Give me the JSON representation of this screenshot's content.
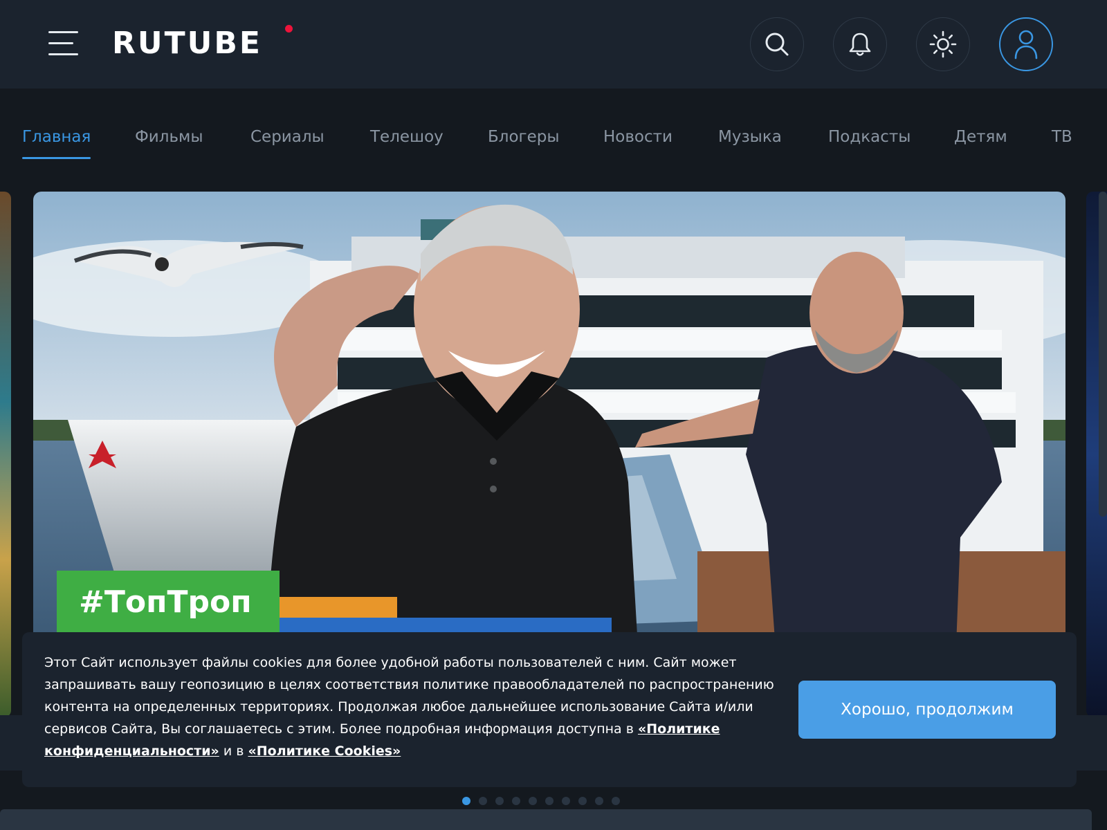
{
  "header": {
    "logo_text": "RUTUBE",
    "menu_icon": "hamburger-menu-icon",
    "icons": [
      "search-icon",
      "bell-icon",
      "sun-theme-icon",
      "user-icon"
    ],
    "accent_color": "#3a97e3",
    "logo_dot_color": "#ed143b"
  },
  "nav": {
    "tabs": [
      {
        "label": "Главная",
        "active": true
      },
      {
        "label": "Фильмы"
      },
      {
        "label": "Сериалы"
      },
      {
        "label": "Телешоу"
      },
      {
        "label": "Блогеры"
      },
      {
        "label": "Новости"
      },
      {
        "label": "Музыка"
      },
      {
        "label": "Подкасты"
      },
      {
        "label": "Детям"
      },
      {
        "label": "ТВ"
      }
    ]
  },
  "banner": {
    "badge_text": "#ТопТроп",
    "badge_color": "#3fae44"
  },
  "cookie": {
    "text_main": "Этот Сайт использует файлы cookies для более удобной работы пользователей с ним. Сайт может запрашивать вашу геопозицию в целях соответствия политике правообладателей по распространению контента на определенных территориях. Продолжая любое дальнейшее использование Сайта и/или сервисов Сайта, Вы соглашаетесь с этим. Более подробная информация доступна в ",
    "link_privacy": "«Политике конфиденциальности»",
    "conjunction": " и в ",
    "link_cookies": "«Политике Cookies»",
    "button_label": "Хорошо, продолжим",
    "button_color": "#4a9ee6"
  },
  "carousel": {
    "dots_count": 10,
    "active_dot": 1
  }
}
